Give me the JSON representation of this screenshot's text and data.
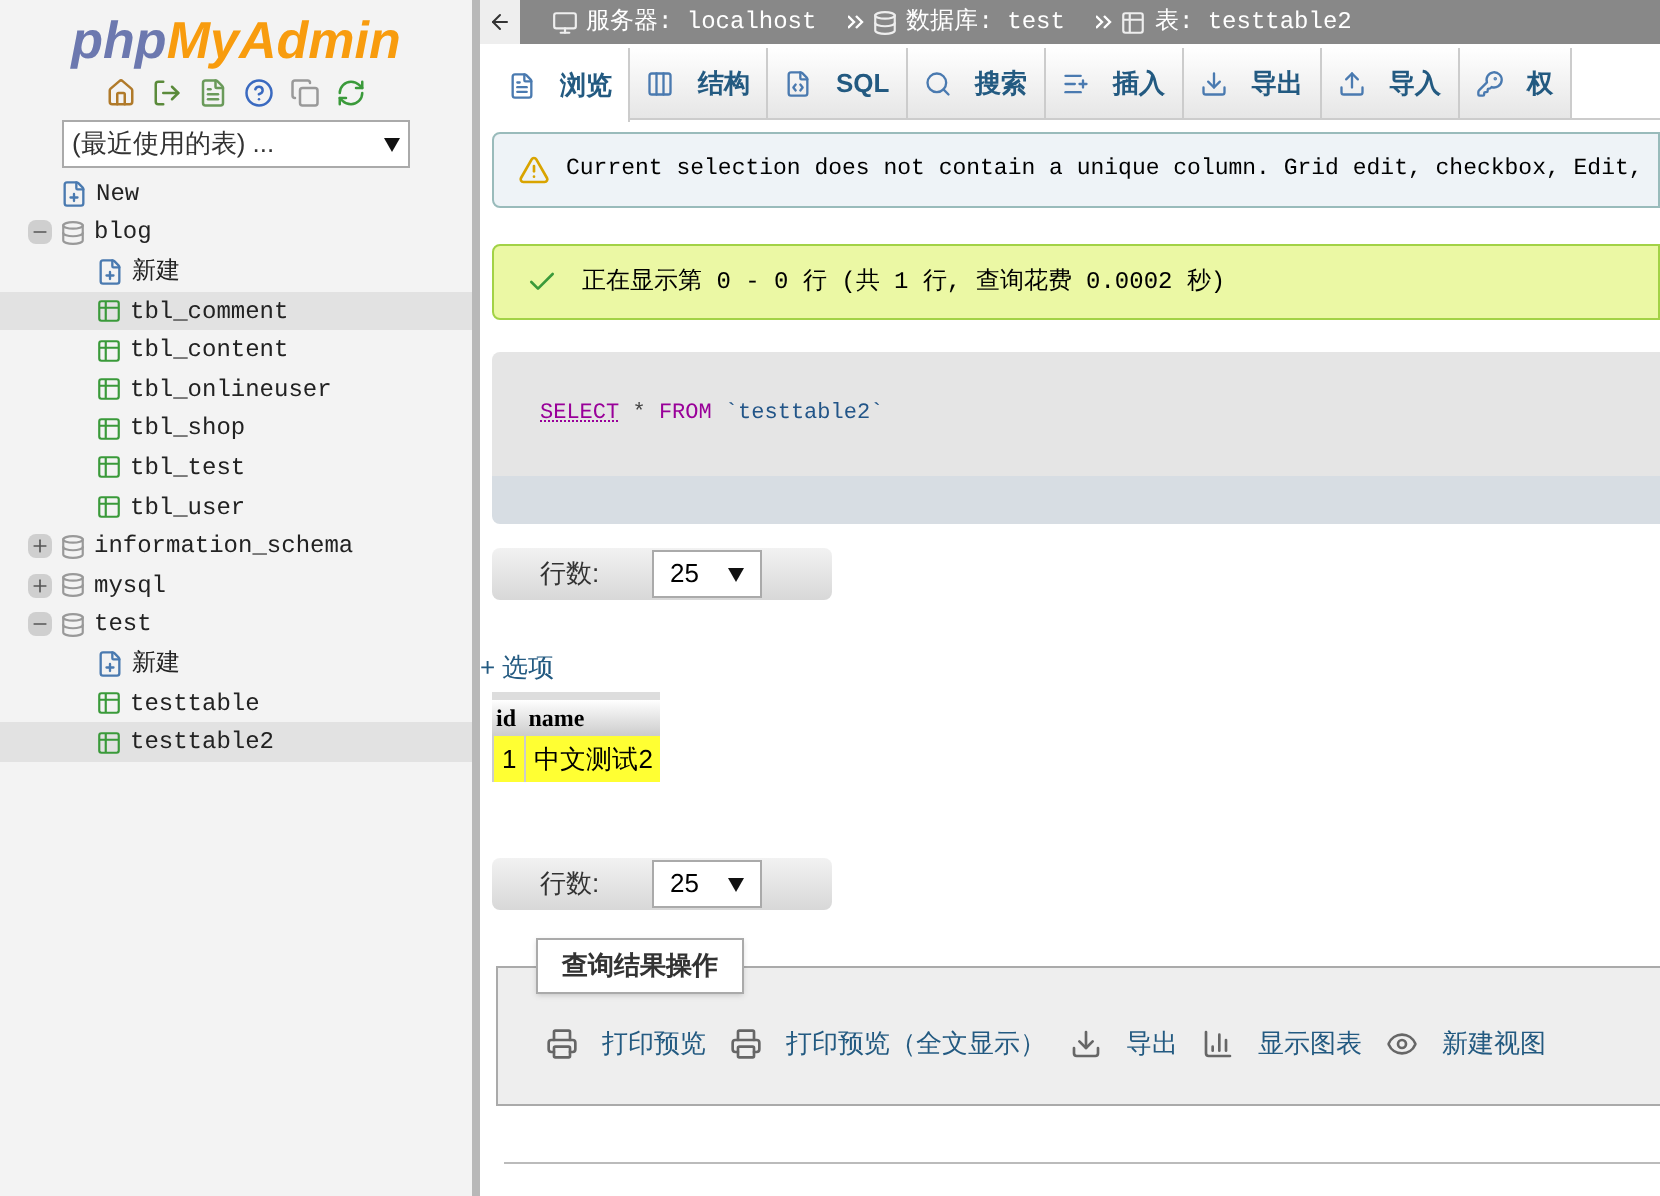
{
  "sidebar": {
    "logo": {
      "part_1": "php",
      "part_2": "MyAdmin"
    },
    "recent_select": {
      "value": "(最近使用的表) ..."
    },
    "tree": [
      {
        "kind": "new",
        "label": "New",
        "selected": false
      },
      {
        "kind": "database",
        "label": "blog",
        "expanded": true,
        "selected": false,
        "children": [
          {
            "kind": "new",
            "label": "新建",
            "selected": false
          },
          {
            "kind": "table",
            "label": "tbl_comment",
            "selected": true
          },
          {
            "kind": "table",
            "label": "tbl_content",
            "selected": false
          },
          {
            "kind": "table",
            "label": "tbl_onlineuser",
            "selected": false
          },
          {
            "kind": "table",
            "label": "tbl_shop",
            "selected": false
          },
          {
            "kind": "table",
            "label": "tbl_test",
            "selected": false
          },
          {
            "kind": "table",
            "label": "tbl_user",
            "selected": false
          }
        ]
      },
      {
        "kind": "database",
        "label": "information_schema",
        "expanded": false,
        "selected": false
      },
      {
        "kind": "database",
        "label": "mysql",
        "expanded": false,
        "selected": false
      },
      {
        "kind": "database",
        "label": "test",
        "expanded": true,
        "selected": false,
        "children": [
          {
            "kind": "new",
            "label": "新建",
            "selected": false
          },
          {
            "kind": "table",
            "label": "testtable",
            "selected": false
          },
          {
            "kind": "table",
            "label": "testtable2",
            "selected": true
          }
        ]
      }
    ]
  },
  "breadcrumb": [
    {
      "kind": "server",
      "text": "服务器: localhost"
    },
    {
      "kind": "database",
      "text": "数据库: test"
    },
    {
      "kind": "table",
      "text": "表: testtable2"
    }
  ],
  "tabs": [
    {
      "label": "浏览",
      "kind": "browse",
      "selected": true
    },
    {
      "label": "结构",
      "kind": "structure",
      "selected": false
    },
    {
      "label": "SQL",
      "kind": "sql",
      "selected": false
    },
    {
      "label": "搜索",
      "kind": "search",
      "selected": false
    },
    {
      "label": "插入",
      "kind": "insert",
      "selected": false
    },
    {
      "label": "导出",
      "kind": "export",
      "selected": false
    },
    {
      "label": "导入",
      "kind": "import",
      "selected": false
    },
    {
      "label": "权",
      "kind": "privileges",
      "selected": false
    }
  ],
  "warning": "Current selection does not contain a unique column. Grid edit, checkbox, Edit,",
  "success": "正在显示第 0 - 0 行 (共 1 行, 查询花费 0.0002 秒)",
  "sql": {
    "keyword_1": "SELECT",
    "operator": "*",
    "keyword_2": "FROM",
    "table": "`testtable2`"
  },
  "rows_control_top": {
    "label": "行数:",
    "value": "25"
  },
  "options_link": "+ 选项",
  "table": {
    "columns": [
      "id",
      "name"
    ],
    "rows": [
      {
        "cells": [
          "1",
          "中文测试2"
        ],
        "highlighted": true
      }
    ]
  },
  "rows_control_bottom": {
    "label": "行数:",
    "value": "25"
  },
  "operations": {
    "title": "查询结果操作",
    "items": [
      {
        "kind": "print",
        "label": "打印预览"
      },
      {
        "kind": "print",
        "label": "打印预览（全文显示）"
      },
      {
        "kind": "export",
        "label": "导出"
      },
      {
        "kind": "chart",
        "label": "显示图表"
      },
      {
        "kind": "view",
        "label": "新建视图"
      }
    ]
  }
}
